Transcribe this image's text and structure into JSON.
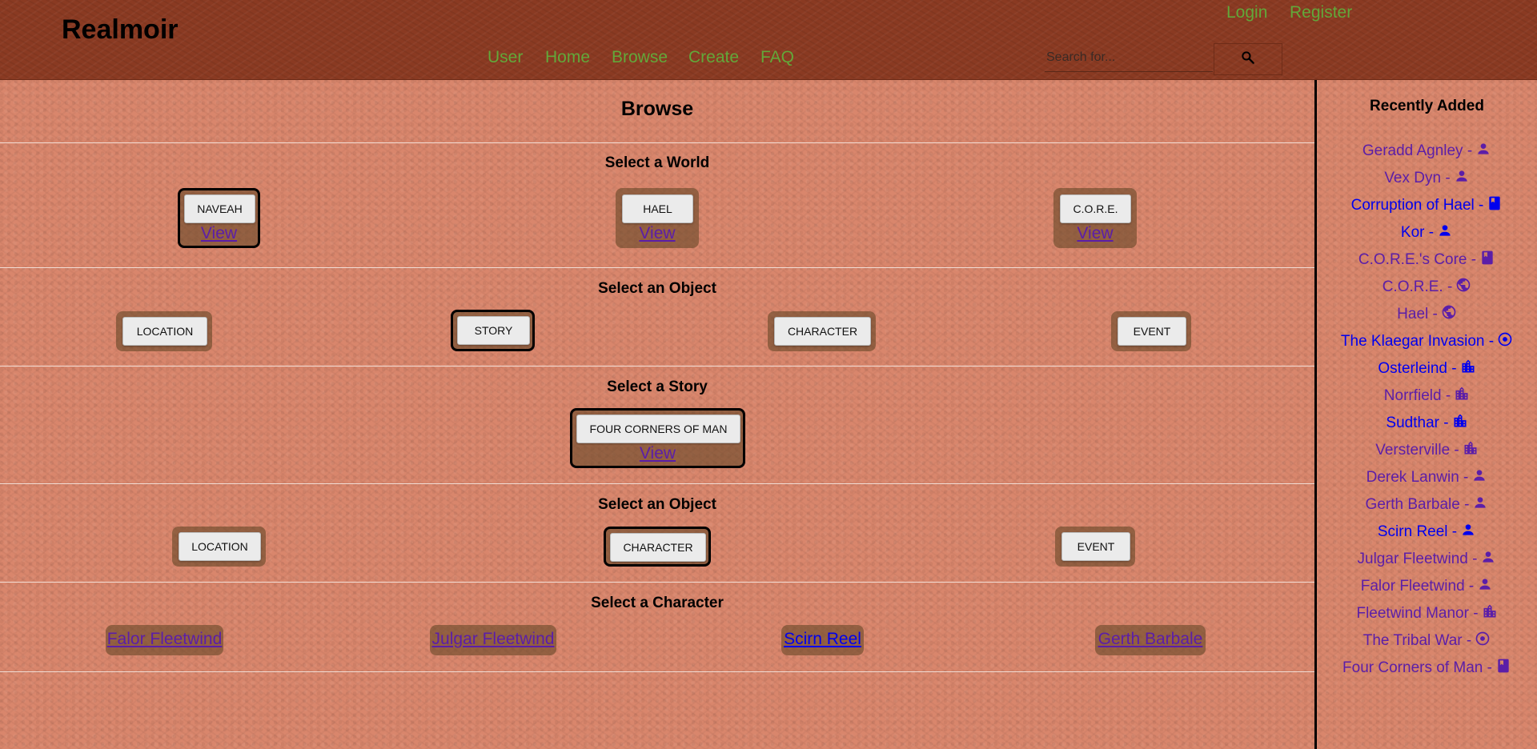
{
  "header": {
    "brand": "Realmoir",
    "auth": {
      "login": "Login",
      "register": "Register"
    },
    "nav": [
      "User",
      "Home",
      "Browse",
      "Create",
      "FAQ"
    ],
    "search": {
      "placeholder": "Search for...",
      "icon": "search-icon"
    }
  },
  "browse": {
    "title": "Browse",
    "world_section": {
      "title": "Select a World",
      "items": [
        {
          "label": "NAVEAH",
          "view": "View",
          "selected": true
        },
        {
          "label": "HAEL",
          "view": "View",
          "selected": false
        },
        {
          "label": "C.O.R.E.",
          "view": "View",
          "selected": false
        }
      ]
    },
    "object_section_1": {
      "title": "Select an Object",
      "items": [
        {
          "label": "LOCATION",
          "selected": false
        },
        {
          "label": "STORY",
          "selected": true
        },
        {
          "label": "CHARACTER",
          "selected": false
        },
        {
          "label": "EVENT",
          "selected": false
        }
      ]
    },
    "story_section": {
      "title": "Select a Story",
      "items": [
        {
          "label": "FOUR CORNERS OF MAN",
          "view": "View",
          "selected": true
        }
      ]
    },
    "object_section_2": {
      "title": "Select an Object",
      "items": [
        {
          "label": "LOCATION",
          "selected": false
        },
        {
          "label": "CHARACTER",
          "selected": true
        },
        {
          "label": "EVENT",
          "selected": false
        }
      ]
    },
    "character_section": {
      "title": "Select a Character",
      "items": [
        {
          "label": "Falor Fleetwind",
          "color": "#5b1ea8"
        },
        {
          "label": "Julgar Fleetwind",
          "color": "#5b1ea8"
        },
        {
          "label": "Scirn Reel",
          "color": "#0000ee"
        },
        {
          "label": "Gerth Barbale",
          "color": "#5b1ea8"
        }
      ]
    }
  },
  "recently_added": {
    "title": "Recently Added",
    "items": [
      {
        "label": "Geradd Agnley -",
        "icon": "person-icon",
        "color": "#5b1ea8"
      },
      {
        "label": "Vex Dyn -",
        "icon": "person-icon",
        "color": "#5b1ea8"
      },
      {
        "label": "Corruption of Hael -",
        "icon": "book-icon",
        "color": "#0000ee"
      },
      {
        "label": "Kor -",
        "icon": "person-icon",
        "color": "#0000ee"
      },
      {
        "label": "C.O.R.E.'s Core -",
        "icon": "book-icon",
        "color": "#5b1ea8"
      },
      {
        "label": "C.O.R.E. -",
        "icon": "globe-icon",
        "color": "#5b1ea8"
      },
      {
        "label": "Hael -",
        "icon": "globe-icon",
        "color": "#5b1ea8"
      },
      {
        "label": "The Klaegar Invasion -",
        "icon": "target-icon",
        "color": "#0000ee"
      },
      {
        "label": "Osterleind -",
        "icon": "city-icon",
        "color": "#0000ee"
      },
      {
        "label": "Norrfield -",
        "icon": "city-icon",
        "color": "#5b1ea8"
      },
      {
        "label": "Sudthar -",
        "icon": "city-icon",
        "color": "#0000ee"
      },
      {
        "label": "Versterville -",
        "icon": "city-icon",
        "color": "#5b1ea8"
      },
      {
        "label": "Derek Lanwin -",
        "icon": "person-icon",
        "color": "#5b1ea8"
      },
      {
        "label": "Gerth Barbale -",
        "icon": "person-icon",
        "color": "#5b1ea8"
      },
      {
        "label": "Scirn Reel -",
        "icon": "person-icon",
        "color": "#0000ee"
      },
      {
        "label": "Julgar Fleetwind -",
        "icon": "person-icon",
        "color": "#5b1ea8"
      },
      {
        "label": "Falor Fleetwind -",
        "icon": "person-icon",
        "color": "#5b1ea8"
      },
      {
        "label": "Fleetwind Manor -",
        "icon": "city-icon",
        "color": "#5b1ea8"
      },
      {
        "label": "The Tribal War -",
        "icon": "target-icon",
        "color": "#5b1ea8"
      },
      {
        "label": "Four Corners of Man -",
        "icon": "book-icon",
        "color": "#5b1ea8"
      }
    ]
  },
  "colors": {
    "nav_link": "#62a83a",
    "visited_link": "#5b1ea8",
    "link": "#0000ee",
    "header_bg": "#8a3a22",
    "page_bg": "#d9866c"
  }
}
